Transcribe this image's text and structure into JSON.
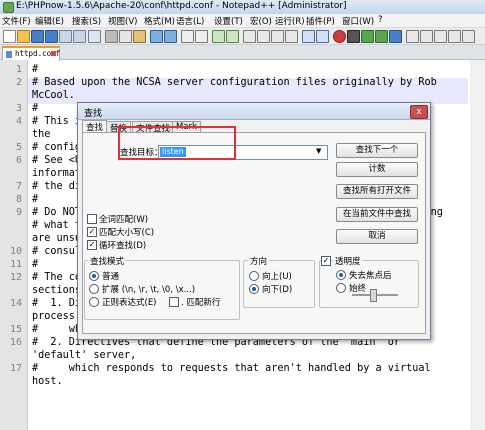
{
  "window": {
    "title": "E:\\PHPnow-1.5.6\\Apache-20\\conf\\httpd.conf - Notepad++ [Administrator]"
  },
  "menu": [
    "文件(F)",
    "编辑(E)",
    "搜索(S)",
    "视图(V)",
    "格式(M)",
    "语言(L)",
    "设置(T)",
    "宏(O)",
    "运行(R)",
    "插件(P)",
    "窗口(W)",
    "?"
  ],
  "tabs": [
    {
      "label": "httpd.conf"
    }
  ],
  "editor": {
    "lines": [
      {
        "n": "1",
        "text": "#"
      },
      {
        "n": "2",
        "text": "# Based upon the NCSA server configuration files originally by Rob"
      },
      {
        "n": "",
        "text": "McCool."
      },
      {
        "n": "3",
        "text": "#"
      },
      {
        "n": "4",
        "text": "# This is the main Apache server configuration file.  It contains"
      },
      {
        "n": "",
        "text": "the"
      },
      {
        "n": "5",
        "text": "# configuration directives that give the server its instructions."
      },
      {
        "n": "6",
        "text": "# See <URL:http://httpd.apache.org/docs/2.0/> for detailed"
      },
      {
        "n": "",
        "text": "information."
      },
      {
        "n": "7",
        "text": "# the directives."
      },
      {
        "n": "8",
        "text": "#"
      },
      {
        "n": "9",
        "text": "# Do NOT simply read the instructions in here without understanding"
      },
      {
        "n": "",
        "text": "# what they do.  They're here only as hints or reminders.  If you"
      },
      {
        "n": "",
        "text": "are unsure"
      },
      {
        "n": "10",
        "text": "# consult the online docs. You have been warned."
      },
      {
        "n": "11",
        "text": "#"
      },
      {
        "n": "12",
        "text": "# The configuration directives are grouped into three basic"
      },
      {
        "n": "",
        "text": "sections:"
      },
      {
        "n": "14",
        "text": "#  1. Directives that control the operation of the Apache server"
      },
      {
        "n": "",
        "text": "process as a"
      },
      {
        "n": "15",
        "text": "#     whole (the 'global environment')."
      },
      {
        "n": "16",
        "text": "#  2. Directives that define the parameters of the 'main' or"
      },
      {
        "n": "",
        "text": "'default' server,"
      },
      {
        "n": "17",
        "text": "#     which responds to requests that aren't handled by a virtual"
      },
      {
        "n": "",
        "text": "host."
      }
    ]
  },
  "find_dialog": {
    "title": "查找",
    "close": "x",
    "tabs": [
      "查找",
      "替换",
      "文件查找",
      "Mark"
    ],
    "find_label": "查找目标：",
    "find_value": "listen",
    "buttons": {
      "find_next": "查找下一个",
      "count": "计数",
      "find_all_open": "查找所有打开文件",
      "find_all_current": "在当前文件中查找",
      "cancel": "取消"
    },
    "options": {
      "whole_word": "全词匹配(W)",
      "match_case": "匹配大小写(C)",
      "wrap": "循环查找(D)"
    },
    "search_mode": {
      "title": "查找模式",
      "normal": "普通",
      "extended": "扩展 (\\n, \\r, \\t, \\0, \\x...)",
      "regex": "正则表达式(E)",
      "dot_newline": ". 匹配新行"
    },
    "direction": {
      "title": "方向",
      "up": "向上(U)",
      "down": "向下(D)"
    },
    "transparency": {
      "title": "透明度",
      "on_lose_focus": "失去焦点后",
      "always": "始终"
    }
  },
  "colors": {
    "highlight_box": "#e0303c",
    "selection": "#3399ff",
    "current_line": "#e8e8ff"
  }
}
